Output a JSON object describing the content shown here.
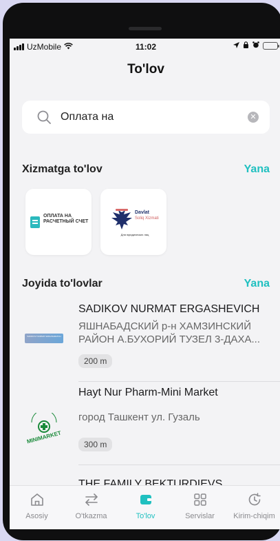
{
  "status_bar": {
    "carrier": "UzMobile",
    "time": "11:02"
  },
  "header": {
    "title": "To'lov"
  },
  "search": {
    "value": "Оплата на"
  },
  "services": {
    "title": "Xizmatga to'lov",
    "more": "Yana",
    "cards": [
      {
        "text": "ОПЛАТА НА РАСЧЕТНЫЙ СЧЕТ"
      },
      {
        "brand": "Davlat",
        "brand_sub": "Soliq Xizmati",
        "caption": "Для юридических лиц"
      }
    ]
  },
  "places": {
    "title": "Joyida to'lovlar",
    "more": "Yana",
    "items": [
      {
        "name": "SADIKOV NURMAT ERGASHEVICH",
        "address": "ЯШНАБАДСКИЙ р-н ХАМЗИНСКИЙ РАЙОН А.БУХОРИЙ ТУЗЕЛ 3-ДАХА...",
        "distance": "200 m",
        "logo_text": "SADIKOV NURMAT ERGASHEVICH"
      },
      {
        "name": "Hayt Nur Pharm-Mini Market",
        "address": "город Ташкент ул. Гузаль",
        "distance": "300 m",
        "logo_text": "MINIMARKET"
      },
      {
        "name": "THE FAMILY BEKTURDIEVS"
      }
    ]
  },
  "tabbar": {
    "tabs": [
      {
        "label": "Asosiy",
        "icon": "home-icon"
      },
      {
        "label": "O'tkazma",
        "icon": "transfer-icon"
      },
      {
        "label": "To'lov",
        "icon": "wallet-icon",
        "active": true
      },
      {
        "label": "Servislar",
        "icon": "grid-icon"
      },
      {
        "label": "Kirim-chiqim",
        "icon": "history-icon"
      }
    ]
  },
  "colors": {
    "accent": "#20c0c0",
    "background": "#f3f3f5",
    "frame": "#0f0f10"
  }
}
